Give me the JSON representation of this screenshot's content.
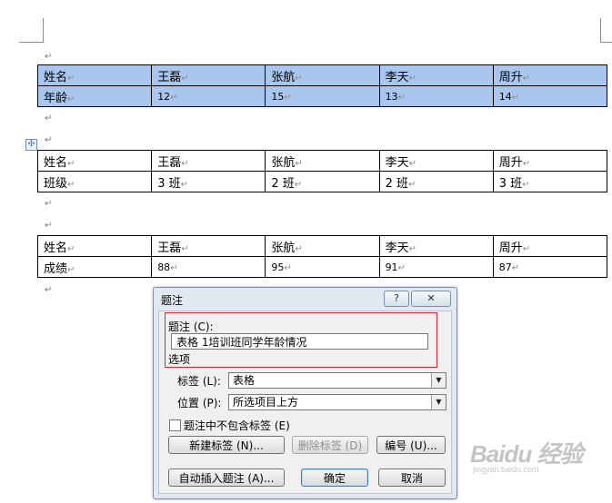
{
  "document": {
    "para_mark": "↵",
    "move_handle": "✣",
    "tables": [
      {
        "selected": true,
        "rows": [
          [
            "姓名",
            "王磊",
            "张航",
            "李天",
            "周升"
          ],
          [
            "年龄",
            "12",
            "15",
            "13",
            "14"
          ]
        ]
      },
      {
        "selected": false,
        "rows": [
          [
            "姓名",
            "王磊",
            "张航",
            "李天",
            "周升"
          ],
          [
            "班级",
            "3 班",
            "2 班",
            "2 班",
            "3 班"
          ]
        ]
      },
      {
        "selected": false,
        "rows": [
          [
            "姓名",
            "王磊",
            "张航",
            "李天",
            "周升"
          ],
          [
            "成绩",
            "88",
            "95",
            "91",
            "87"
          ]
        ]
      }
    ]
  },
  "dialog": {
    "title": "题注",
    "help_label": "?",
    "close_label": "✕",
    "caption_label": "题注 (C):",
    "caption_value": "表格 1培训班同学年龄情况",
    "options_label": "选项",
    "label_label": "标签 (L):",
    "label_value": "表格",
    "position_label": "位置 (P):",
    "position_value": "所选项目上方",
    "exclude_label": "题注中不包含标签 (E)",
    "new_label_button": "新建标签 (N)...",
    "delete_label_button": "删除标签 (D)",
    "numbering_button": "编号 (U)...",
    "auto_caption_button": "自动插入题注 (A)...",
    "ok_button": "确定",
    "cancel_button": "取消",
    "dropdown_arrow": "▼"
  },
  "watermark": {
    "brand": "Baidu 经验",
    "url": "jingyan.baidu.com"
  }
}
